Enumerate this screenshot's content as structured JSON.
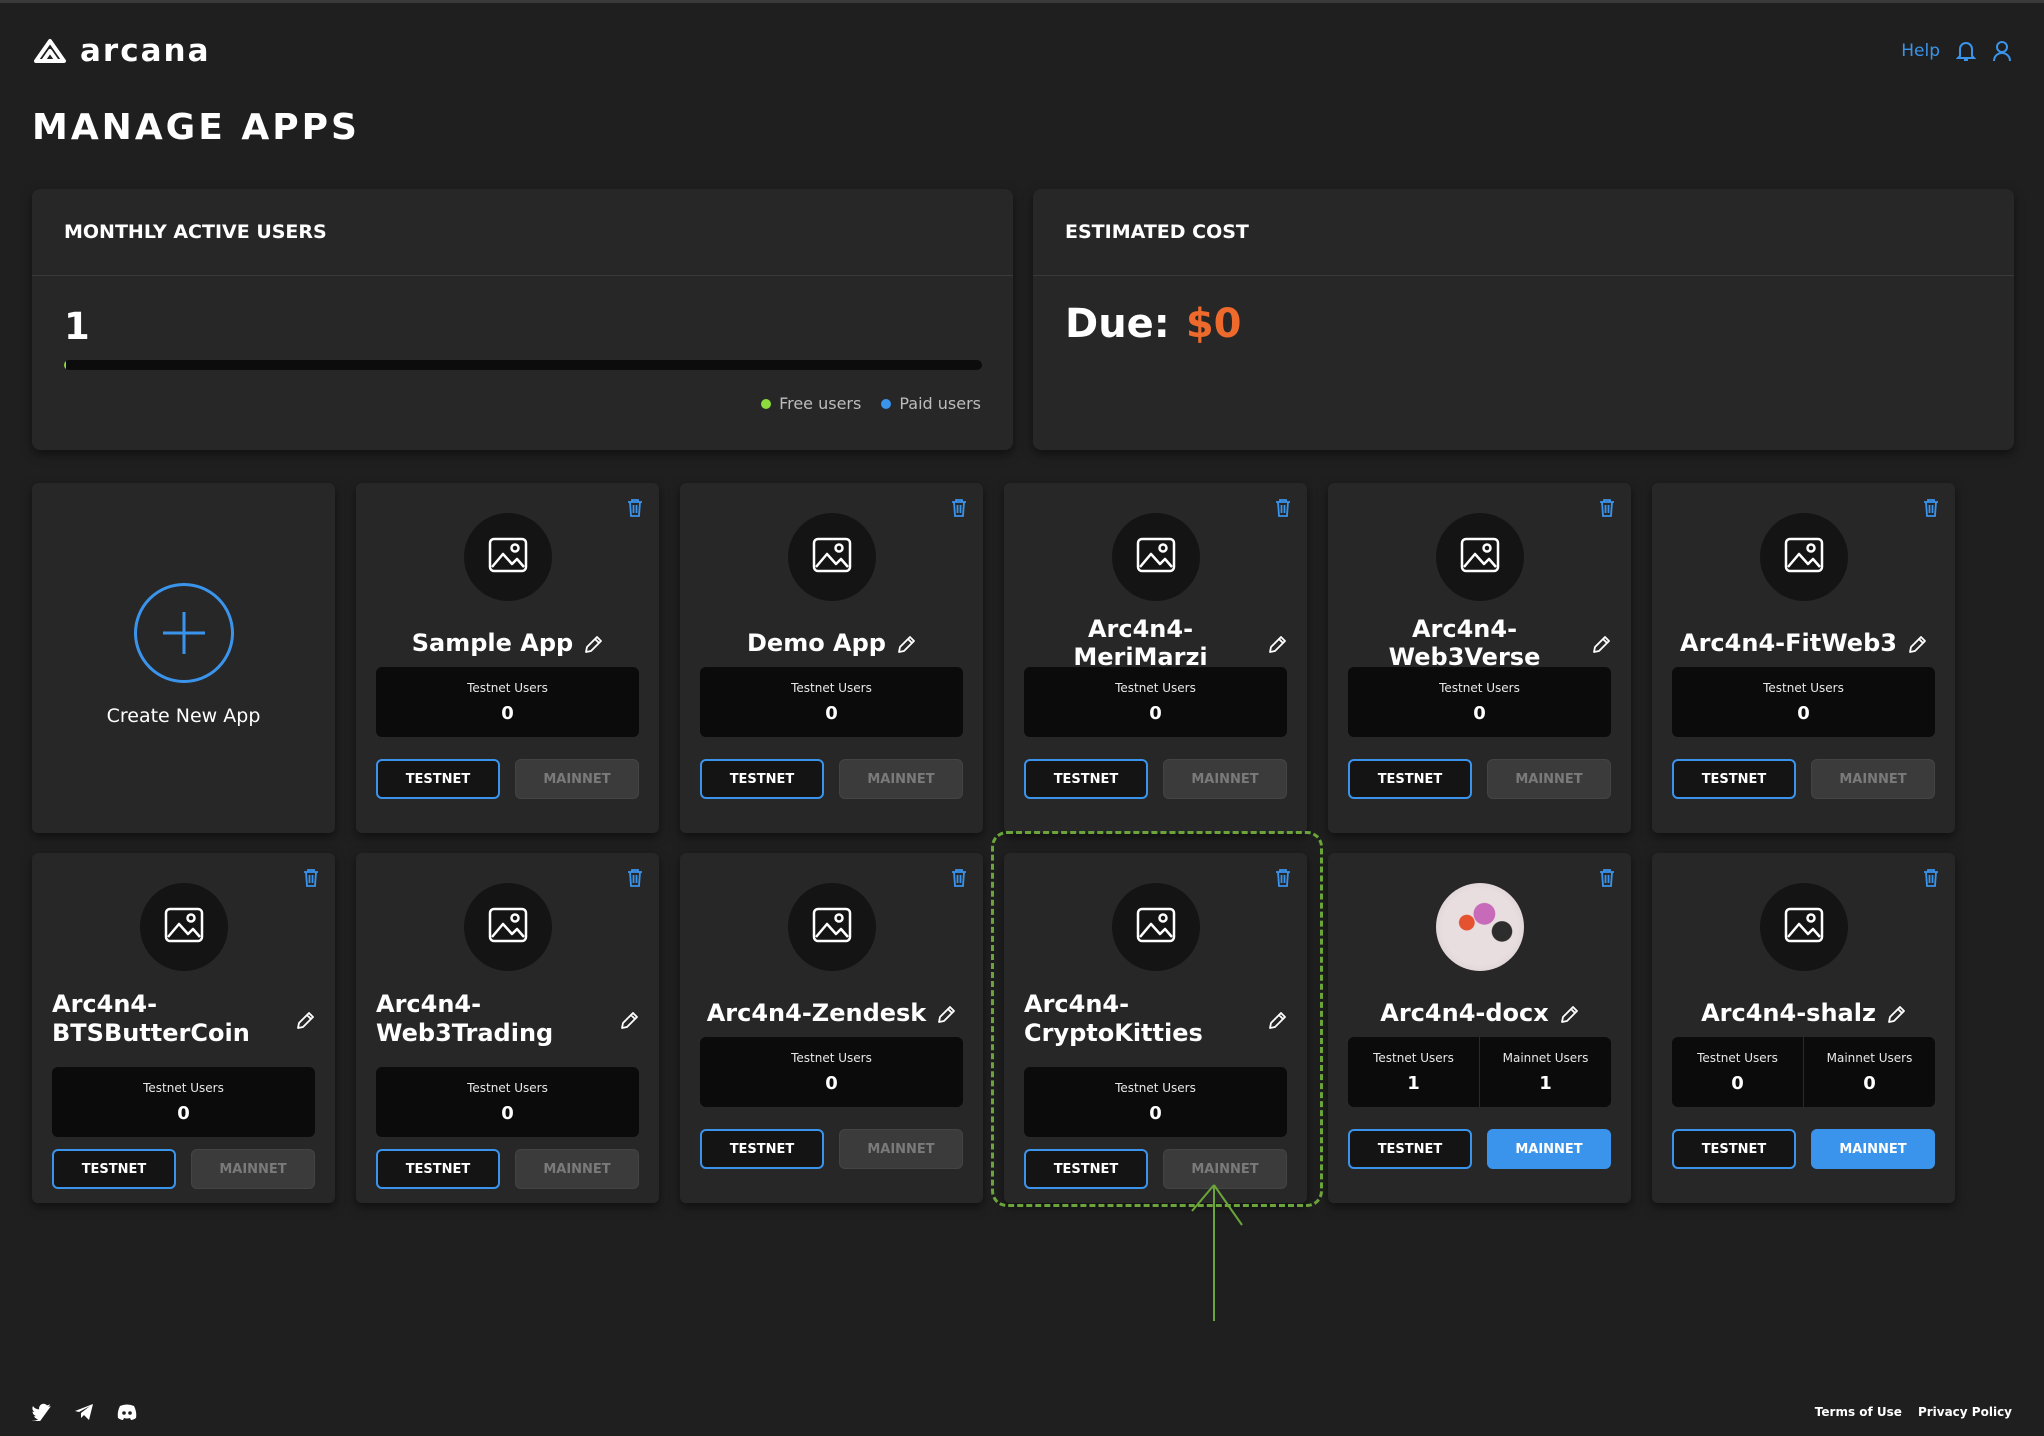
{
  "brand": {
    "name": "arcana"
  },
  "header": {
    "help": "Help",
    "icons": [
      "bell-icon",
      "user-icon"
    ]
  },
  "page_title": "MANAGE APPS",
  "mau": {
    "title": "MONTHLY ACTIVE USERS",
    "count": "1",
    "progress_fraction": 0.002,
    "legend_free": "Free users",
    "legend_paid": "Paid users",
    "colors": {
      "free": "#8bdc3c",
      "paid": "#3b94ec"
    }
  },
  "cost": {
    "title": "ESTIMATED COST",
    "due_label": "Due:",
    "due_value": "$0",
    "accent": "#ee6a2c"
  },
  "create": {
    "label": "Create New App"
  },
  "apps": [
    {
      "name": "Sample App",
      "testnet_label": "Testnet Users",
      "testnet_users": "0",
      "testnet_btn": "TESTNET",
      "mainnet_btn": "MAINNET"
    },
    {
      "name": "Demo App",
      "testnet_label": "Testnet Users",
      "testnet_users": "0",
      "testnet_btn": "TESTNET",
      "mainnet_btn": "MAINNET"
    },
    {
      "name": "Arc4n4-MeriMarzi",
      "testnet_label": "Testnet Users",
      "testnet_users": "0",
      "testnet_btn": "TESTNET",
      "mainnet_btn": "MAINNET"
    },
    {
      "name": "Arc4n4-Web3Verse",
      "testnet_label": "Testnet Users",
      "testnet_users": "0",
      "testnet_btn": "TESTNET",
      "mainnet_btn": "MAINNET"
    },
    {
      "name": "Arc4n4-FitWeb3",
      "testnet_label": "Testnet Users",
      "testnet_users": "0",
      "testnet_btn": "TESTNET",
      "mainnet_btn": "MAINNET"
    },
    {
      "name": "Arc4n4-BTSButterCoin",
      "name_l1": "Arc4n4-",
      "name_l2": "BTSButterCoin",
      "testnet_label": "Testnet Users",
      "testnet_users": "0",
      "testnet_btn": "TESTNET",
      "mainnet_btn": "MAINNET"
    },
    {
      "name": "Arc4n4-Web3Trading",
      "name_l1": "Arc4n4-",
      "name_l2": "Web3Trading",
      "testnet_label": "Testnet Users",
      "testnet_users": "0",
      "testnet_btn": "TESTNET",
      "mainnet_btn": "MAINNET"
    },
    {
      "name": "Arc4n4-Zendesk",
      "testnet_label": "Testnet Users",
      "testnet_users": "0",
      "testnet_btn": "TESTNET",
      "mainnet_btn": "MAINNET"
    },
    {
      "name": "Arc4n4-CryptoKitties",
      "name_l1": "Arc4n4-",
      "name_l2": "CryptoKitties",
      "testnet_label": "Testnet Users",
      "testnet_users": "0",
      "testnet_btn": "TESTNET",
      "mainnet_btn": "MAINNET",
      "highlighted": true
    },
    {
      "name": "Arc4n4-docx",
      "testnet_label": "Testnet Users",
      "testnet_users": "1",
      "mainnet_label": "Mainnet Users",
      "mainnet_users": "1",
      "testnet_btn": "TESTNET",
      "mainnet_btn": "MAINNET",
      "mainnet_enabled": true,
      "has_logo": true
    },
    {
      "name": "Arc4n4-shalz",
      "testnet_label": "Testnet Users",
      "testnet_users": "0",
      "mainnet_label": "Mainnet Users",
      "mainnet_users": "0",
      "testnet_btn": "TESTNET",
      "mainnet_btn": "MAINNET",
      "mainnet_enabled": true
    }
  ],
  "footer": {
    "social": [
      "twitter-icon",
      "telegram-icon",
      "discord-icon"
    ],
    "terms": "Terms of Use",
    "privacy": "Privacy Policy"
  },
  "colors": {
    "background": "#1f1f1f",
    "card": "#272727",
    "accent": "#3b94ec",
    "annotation": "#6aa43a"
  }
}
